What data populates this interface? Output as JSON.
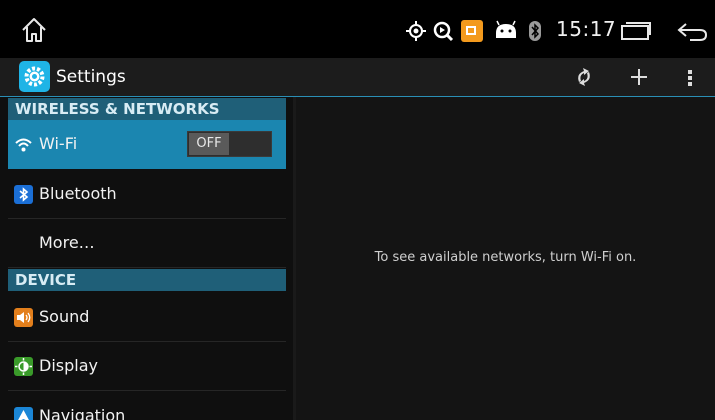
{
  "statusbar": {
    "time": "15:17",
    "icons": [
      "home-icon",
      "location-icon",
      "search-icon",
      "media-app-icon",
      "android-debug-icon",
      "bluetooth-icon",
      "recents-icon",
      "back-icon"
    ]
  },
  "actionbar": {
    "title": "Settings",
    "buttons": [
      "sync-icon",
      "add-icon",
      "overflow-menu-icon"
    ]
  },
  "sidebar": {
    "sections": [
      {
        "header": "WIRELESS & NETWORKS",
        "items": [
          {
            "label": "Wi-Fi",
            "icon": "wifi-icon",
            "toggle": "OFF",
            "selected": true
          },
          {
            "label": "Bluetooth",
            "icon": "bluetooth-icon"
          },
          {
            "label": "More…",
            "icon": ""
          }
        ]
      },
      {
        "header": "DEVICE",
        "items": [
          {
            "label": "Sound",
            "icon": "sound-icon"
          },
          {
            "label": "Display",
            "icon": "display-icon"
          },
          {
            "label": "Navigation",
            "icon": "navigation-icon"
          }
        ]
      }
    ]
  },
  "detail": {
    "message": "To see available networks, turn Wi-Fi on."
  },
  "colors": {
    "accent": "#1b86b0",
    "section_header": "#1f5f78",
    "background": "#000000"
  }
}
